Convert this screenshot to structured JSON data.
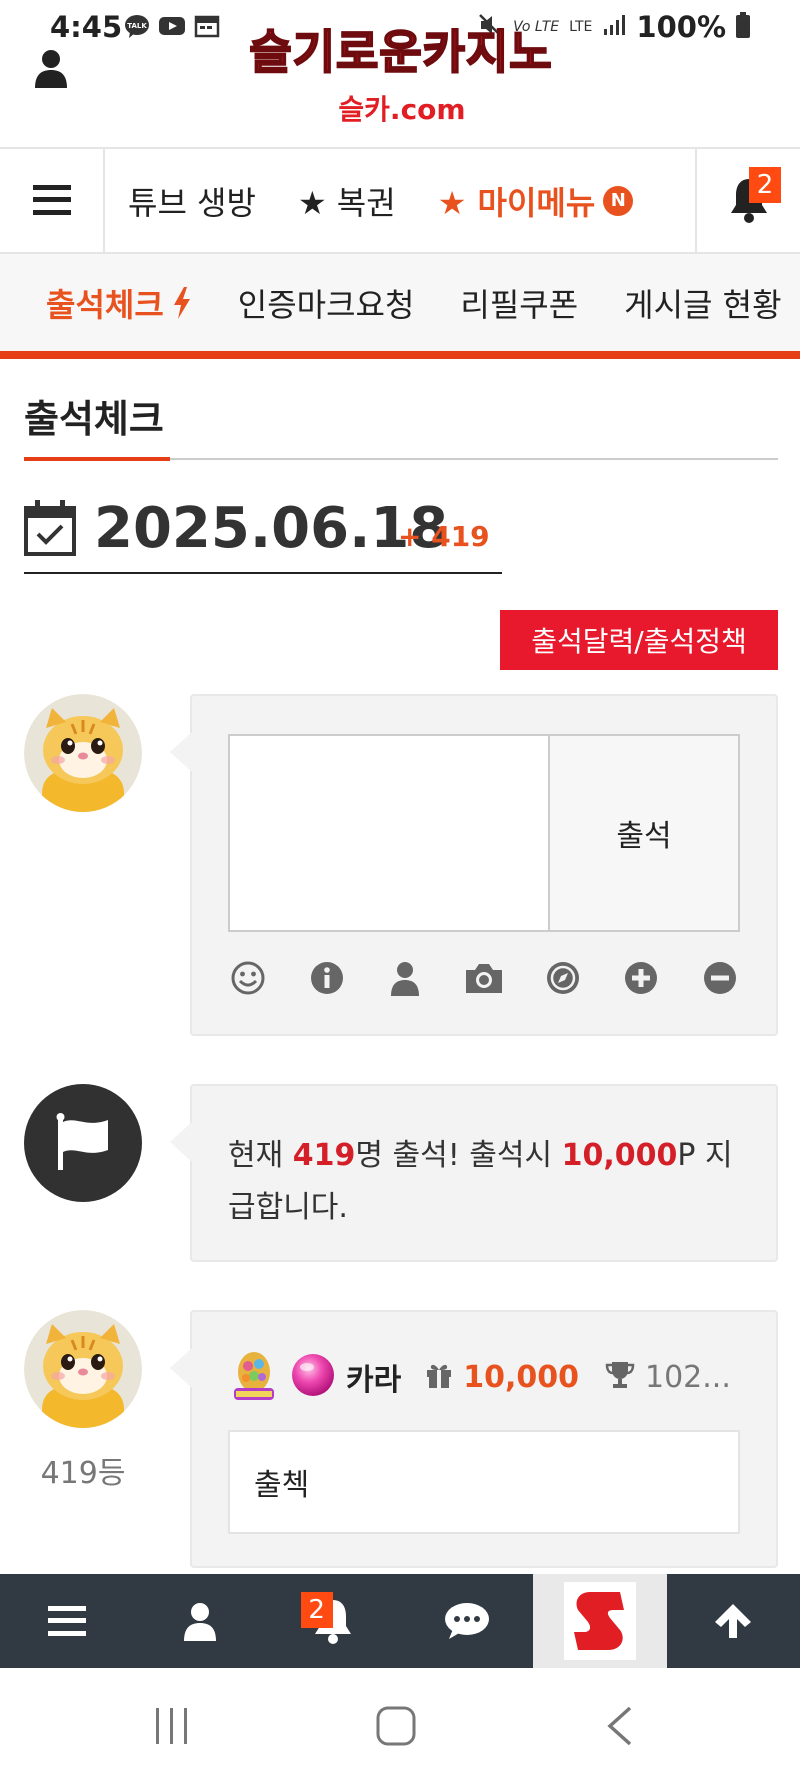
{
  "status_bar": {
    "time": "4:45",
    "battery": "100%",
    "icons_left": [
      "kakao-talk-icon",
      "youtube-icon",
      "calendar-icon"
    ],
    "icons_right": [
      "mute-icon",
      "volte-icon",
      "lte-icon",
      "signal-icon",
      "battery-icon"
    ]
  },
  "header": {
    "logo_text": "슬기로운카지노",
    "logo_sub": "슬카.com"
  },
  "nav": {
    "items": [
      "튜브 생방",
      "★ 복권"
    ],
    "mymenu_label": "★ 마이메뉴",
    "mymenu_badge": "N",
    "bell_badge": "2"
  },
  "subnav": {
    "active": "출석체크",
    "items": [
      "인증마크요청",
      "리필쿠폰",
      "게시글 현황"
    ]
  },
  "page": {
    "title": "출석체크",
    "date": "2025.06.18",
    "count_plus": "+ 419",
    "calendar_button": "출석달력/출석정책"
  },
  "comment_form": {
    "textarea_value": "",
    "submit_label": "출석",
    "tools": [
      "smile-icon",
      "info-icon",
      "user-icon",
      "camera-icon",
      "compass-icon",
      "plus-circle-icon",
      "minus-circle-icon"
    ]
  },
  "notice": {
    "prefix": "현재 ",
    "count": "419",
    "middle": "명 출석! 출석시 ",
    "points": "10,000",
    "suffix": "P 지급합니다."
  },
  "entry": {
    "username": "카라",
    "points": "10,000",
    "exp": "102...",
    "message": "출첵",
    "rank": "419등"
  },
  "bottom_bar": {
    "bell_badge": "2",
    "icons": [
      "menu-icon",
      "user-icon",
      "bell-icon",
      "chat-icon",
      "site-logo",
      "arrow-up-icon"
    ]
  },
  "colors": {
    "accent": "#e8521f",
    "red": "#e8192c",
    "dark_bar": "#313942"
  }
}
